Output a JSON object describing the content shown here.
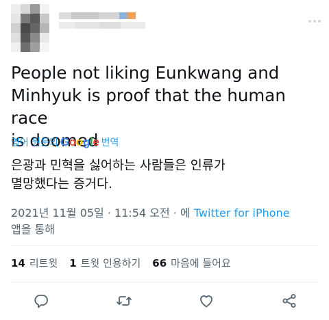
{
  "colors": {
    "link": "#1d9bf0",
    "secondary_text": "#536471",
    "primary_text": "#0f1419",
    "divider": "#eff3f4"
  },
  "tweet": {
    "text_lines": [
      "People not liking Eunkwang and",
      "Minhyuk is proof that the human race",
      "is doomed"
    ],
    "translate": {
      "prefix": "영어 원문의",
      "brand": "Google",
      "suffix": "번역"
    },
    "translated_lines": [
      "은광과 민혁을 싫어하는 사람들은 인류가",
      "멸망했다는 증거다."
    ],
    "timestamp": "2021년 11월 05일 · 11:54 오전 · 에",
    "source": "Twitter for iPhone",
    "source_suffix": "앱을 통해"
  },
  "stats": {
    "retweets_count": "14",
    "retweets_label": "리트윗",
    "quotes_count": "1",
    "quotes_label": "트윗 인용하기",
    "likes_count": "66",
    "likes_label": "마음에 들어요"
  },
  "actions": {
    "reply_icon": "reply-icon",
    "retweet_icon": "retweet-icon",
    "like_icon": "heart-icon",
    "share_icon": "share-icon"
  }
}
